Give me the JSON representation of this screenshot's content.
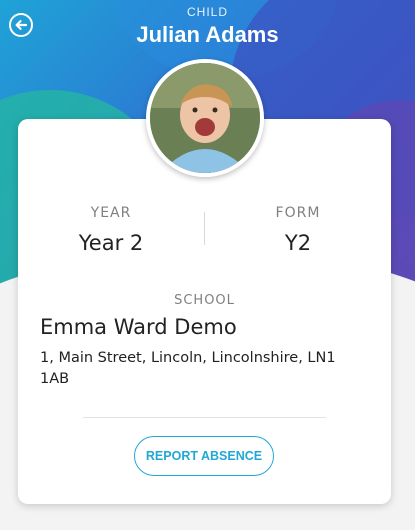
{
  "header": {
    "label": "CHILD",
    "name": "Julian Adams",
    "back_icon": "back-arrow-icon"
  },
  "avatar": {
    "description_icon": "child-photo"
  },
  "details": {
    "year_label": "YEAR",
    "year_value": "Year 2",
    "form_label": "FORM",
    "form_value": "Y2"
  },
  "school": {
    "label": "SCHOOL",
    "name": "Emma Ward Demo",
    "address": "1, Main Street, Lincoln, Lincolnshire, LN1 1AB"
  },
  "actions": {
    "report_absence": "REPORT ABSENCE"
  },
  "colors": {
    "accent": "#21a8d6",
    "text": "#222222",
    "muted": "#808080"
  }
}
